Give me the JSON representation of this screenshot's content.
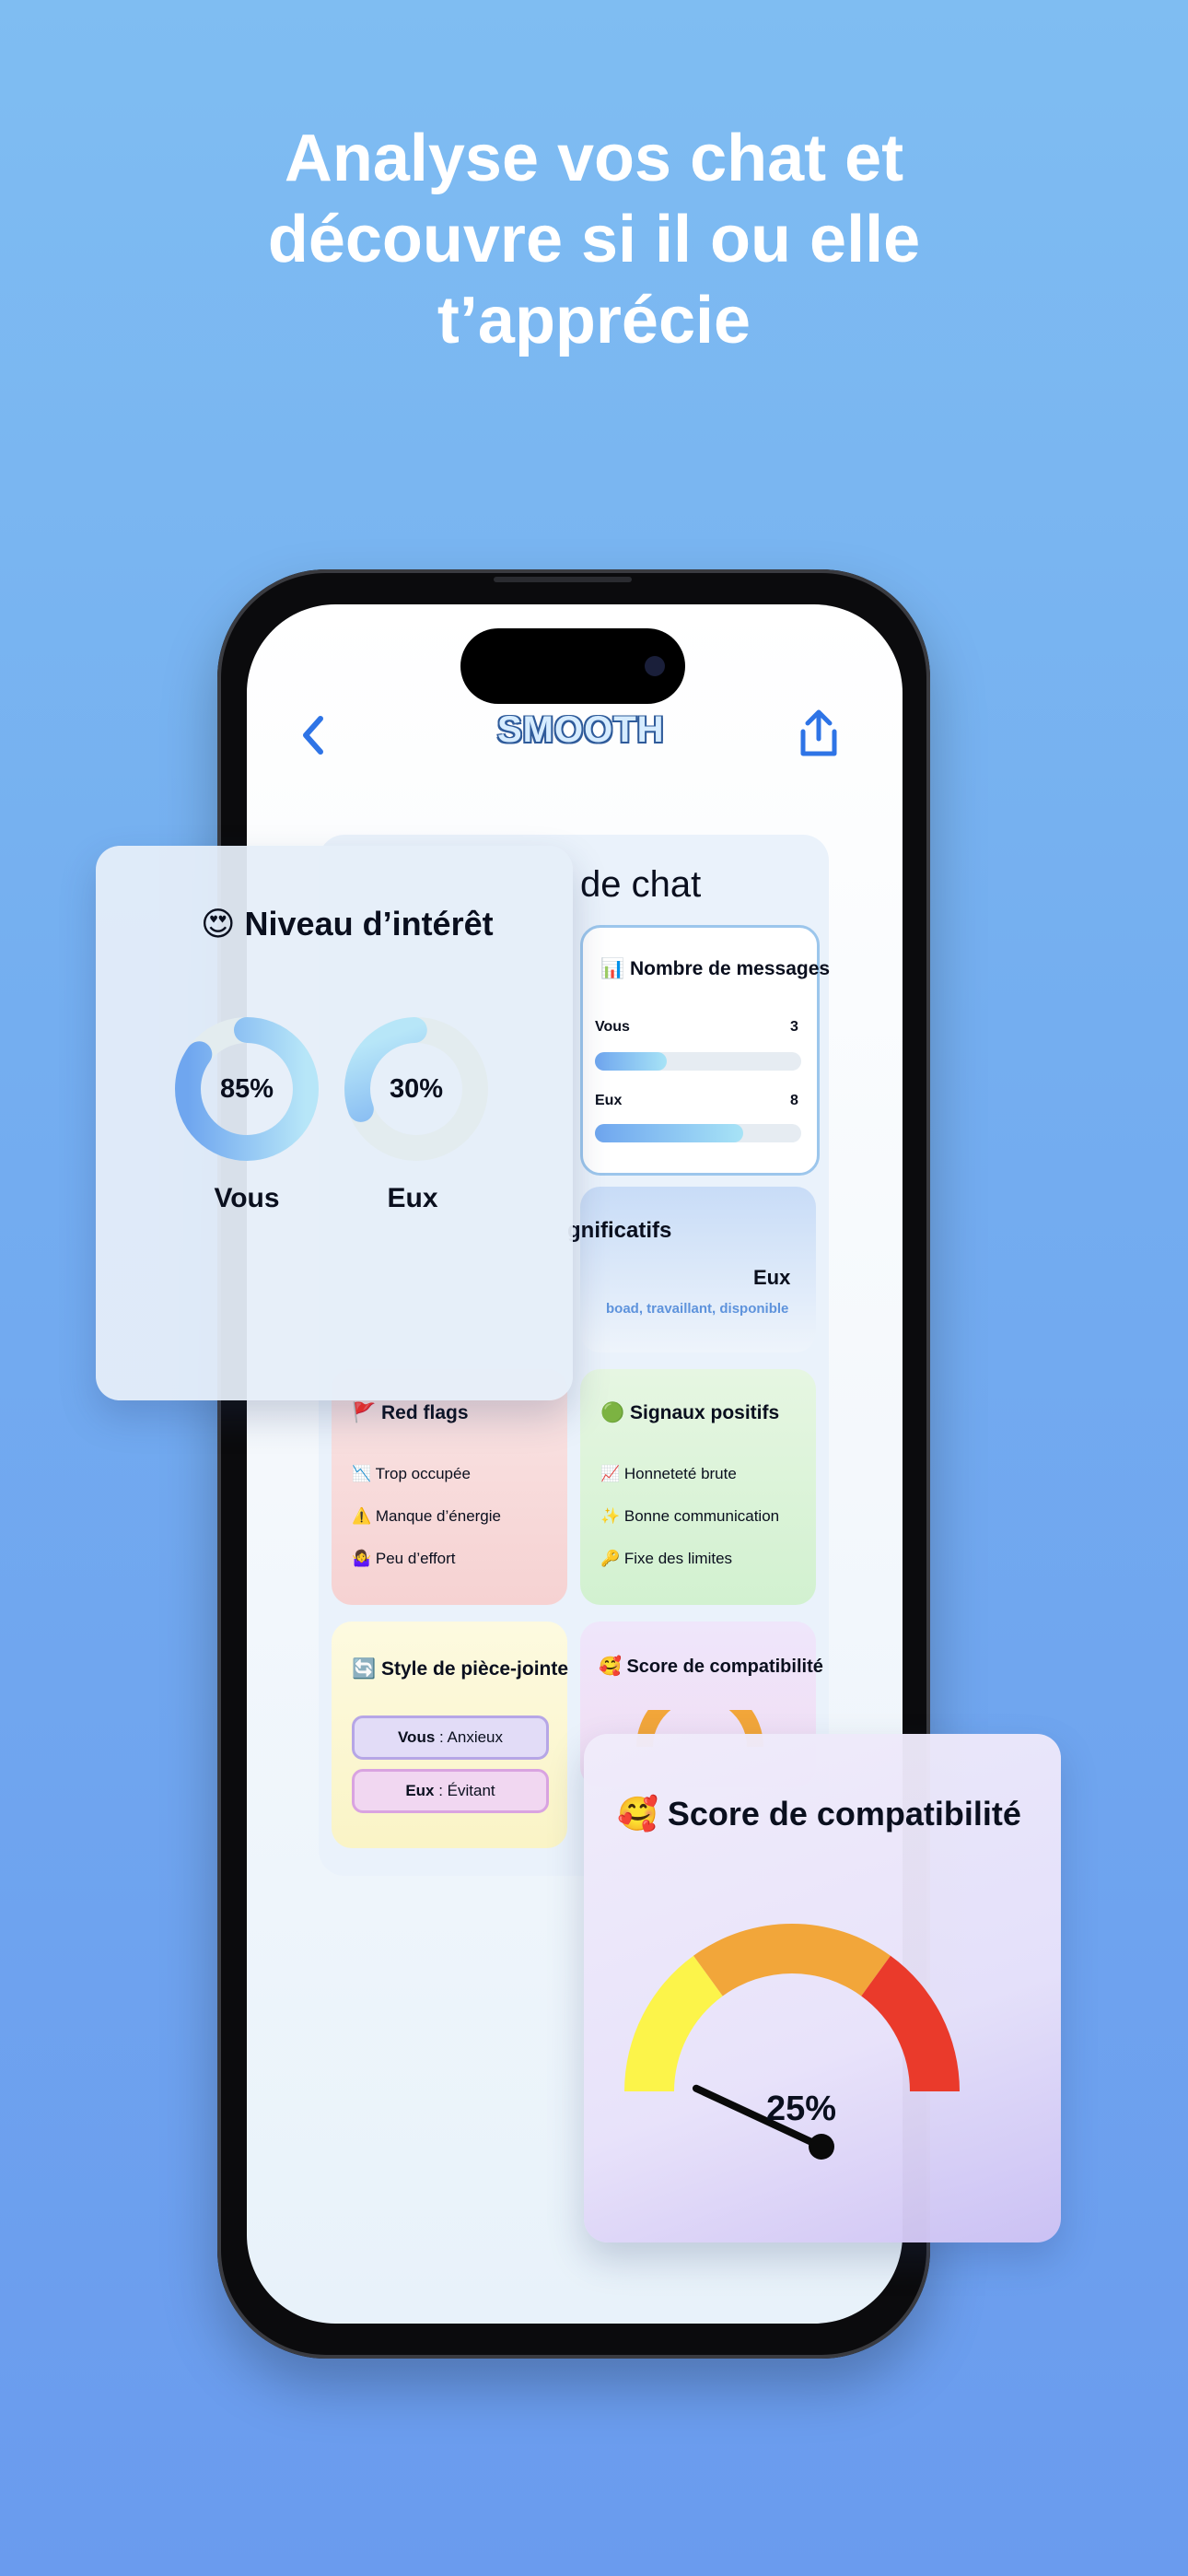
{
  "headline": [
    "Analyse vos chat et",
    "découvre si il ou elle",
    "t’apprécie"
  ],
  "app": {
    "back_icon": "chevron-left-icon",
    "logo_text": "SMOOTH",
    "share_icon": "share-icon",
    "accent_color": "#2e74e6"
  },
  "panel": {
    "title_visible": "de chat"
  },
  "messages_card": {
    "title": "📊 Nombre de messages",
    "rows": [
      {
        "label": "Vous",
        "count": "3",
        "fraction": 0.35
      },
      {
        "label": "Eux",
        "count": "8",
        "fraction": 0.72
      }
    ]
  },
  "significant_card": {
    "title_visible": "gnificatifs",
    "who": "Eux",
    "words": "boad, travaillant, disponible"
  },
  "red_flags": {
    "title": "🚩 Red flags",
    "items": [
      "📉 Trop occupée",
      "⚠️ Manque d’énergie",
      "🤷‍♀️ Peu d’effort"
    ]
  },
  "positive": {
    "title": "🟢 Signaux positifs",
    "items": [
      "📈 Honneteté brute",
      "✨ Bonne communication",
      "🔑 Fixe des limites"
    ]
  },
  "attachment": {
    "title": "🔄 Style de pièce-jointe",
    "you_label": "Vous",
    "you_value": " : Anxieux",
    "them_label": "Eux",
    "them_value": " : Évitant"
  },
  "compat_small": {
    "title": "🥰 Score de compatibilité"
  },
  "interest": {
    "title": "😍 Niveau d’intérêt",
    "rings": [
      {
        "name": "Vous",
        "percent_label": "85%",
        "percent": 85
      },
      {
        "name": "Eux",
        "percent_label": "30%",
        "percent": 30
      }
    ]
  },
  "compat": {
    "title": "🥰 Score de compatibilité",
    "score_label": "25%",
    "score": 25,
    "colors": [
      "#fcf44a",
      "#f2a63a",
      "#ea3a2b"
    ]
  }
}
